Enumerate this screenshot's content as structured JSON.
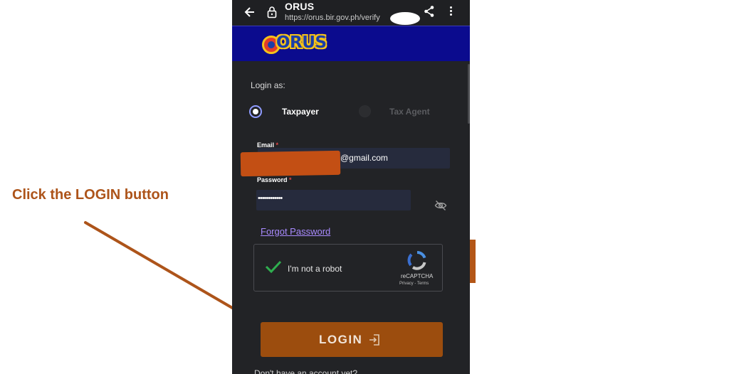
{
  "browser": {
    "title": "ORUS",
    "url": "https://orus.bir.gov.ph/verify",
    "icons": [
      "back-arrow-icon",
      "lock-icon",
      "share-icon",
      "more-vert-icon"
    ]
  },
  "brand": {
    "logo_text": "ORUS",
    "colors": {
      "band": "#0b0b8e",
      "logo_blue": "#1a3ea8",
      "logo_yellow": "#f4c21a",
      "logo_red": "#e33b2a"
    }
  },
  "login_form": {
    "login_as_label": "Login as:",
    "options": [
      {
        "label": "Taxpayer",
        "selected": true
      },
      {
        "label": "Tax Agent",
        "selected": false
      }
    ],
    "email_label": "Email",
    "email_value_visible": "@gmail.com",
    "password_label": "Password",
    "password_value": "••••••••••••",
    "required_mark": "*",
    "forgot_password": "Forgot Password",
    "captcha": {
      "label": "I'm not a robot",
      "brand": "reCAPTCHA",
      "links": "Privacy - Terms",
      "checked": true
    },
    "login_button": "LOGIN",
    "signup_prompt": "Don't have an account yet?"
  },
  "annotation": {
    "instruction": "Click the LOGIN button",
    "color": "#ad541a"
  },
  "colors": {
    "screen_bg": "#222326",
    "input_bg": "#262b3d",
    "accent_link": "#a98bff",
    "login_button": "#9c4d0e",
    "redaction": "#c34f14"
  }
}
